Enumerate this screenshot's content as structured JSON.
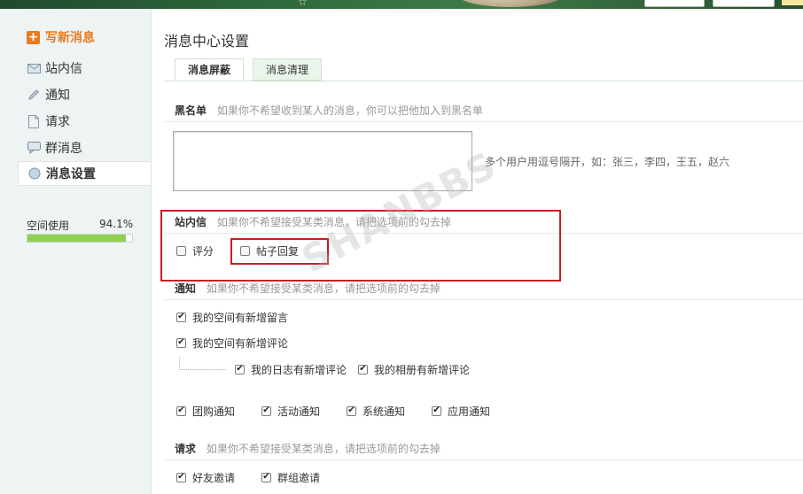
{
  "sidebar": {
    "write_label": "写新消息",
    "items": [
      {
        "label": "站内信",
        "icon": "envelope-icon"
      },
      {
        "label": "通知",
        "icon": "pencil-icon"
      },
      {
        "label": "请求",
        "icon": "document-icon"
      },
      {
        "label": "群消息",
        "icon": "chat-bubble-icon"
      },
      {
        "label": "消息设置",
        "icon": "circle-icon"
      }
    ],
    "space_label": "空间使用",
    "space_value": "94.1%",
    "space_fraction": 0.941
  },
  "main": {
    "title": "消息中心设置",
    "tabs": [
      {
        "label": "消息屏蔽",
        "active": true
      },
      {
        "label": "消息清理",
        "active": false
      }
    ],
    "blacklist": {
      "title": "黑名单",
      "desc": "如果你不希望收到某人的消息，你可以把他加入到黑名单",
      "hint": "多个用户用逗号隔开，如：张三，李四，王五，赵六",
      "value": ""
    },
    "pm": {
      "title": "站内信",
      "desc": "如果你不希望接受某类消息，请把选项前的勾去掉",
      "options": [
        {
          "label": "评分",
          "checked": false
        },
        {
          "label": "帖子回复",
          "checked": false
        }
      ]
    },
    "notice": {
      "title": "通知",
      "desc": "如果你不希望接受某类消息，请把选项前的勾去掉",
      "options": [
        {
          "label": "我的空间有新增留言",
          "checked": true
        },
        {
          "label": "我的空间有新增评论",
          "checked": true
        },
        {
          "label": "我的日志有新增评论",
          "checked": true
        },
        {
          "label": "我的相册有新增评论",
          "checked": true
        },
        {
          "label": "团购通知",
          "checked": true
        },
        {
          "label": "活动通知",
          "checked": true
        },
        {
          "label": "系统通知",
          "checked": true
        },
        {
          "label": "应用通知",
          "checked": true
        }
      ]
    },
    "request": {
      "title": "请求",
      "desc": "如果你不希望接受某类消息，请把选项前的勾去掉",
      "options": [
        {
          "label": "好友邀请",
          "checked": true
        },
        {
          "label": "群组邀请",
          "checked": true
        }
      ]
    }
  },
  "colors": {
    "accent_orange": "#e97a1e",
    "highlight_red": "#c81f24",
    "progress_green": "#8fd14f",
    "sidebar_bg": "#eef3f3"
  }
}
